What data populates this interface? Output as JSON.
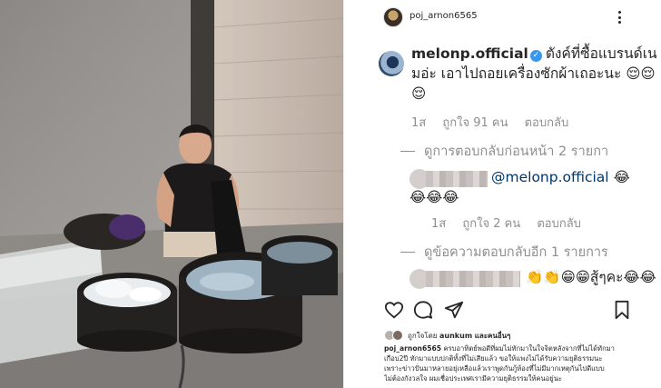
{
  "post": {
    "author": "poj_arnon6565"
  },
  "main_comment": {
    "username": "melonp.official",
    "text": "ตังค์ที่ซื้อแบรนด์เนมอ่ะ เอาไปถอยเครื่องซักผ้าเถอะนะ 😌😌😌",
    "time": "1ส",
    "likes": "ถูกใจ 91 คน",
    "reply_label": "ตอบกลับ"
  },
  "view_previous": "ดูการตอบกลับก่อนหน้า 2 รายกา",
  "reply1": {
    "mention": "@melonp.official",
    "emoji_line1": "😂",
    "emoji_line2": "😂😂😂",
    "time": "1ส",
    "likes": "ถูกใจ 2 คน",
    "reply_label": "ตอบกลับ"
  },
  "view_more": "ดูข้อความตอบกลับอีก 1 รายการ",
  "reply2": {
    "text": "👏👏😁😁สู้ๆคะ😂😂"
  },
  "likes_row": {
    "prefix": "ถูกใจโดย",
    "user": "aunkum",
    "suffix": "และคนอื่นๆ"
  },
  "caption": {
    "username": "poj_arnon6565",
    "line1": "ครบอาทิตย์พอดีที่ผมไม่ทักมาในใจจิตหลังจากที่ไม่ได้ทักมา",
    "line2": "เกือบ2ปี ทักมาแบบปกติทั้งที่ไม่เสียแล้ว ขอให้แพงไม่ได้รับความยุติธรรมนะ",
    "line3": "เพราะข่าวปั่นมาหลายอยุ่เหลือแล้วเราพูดกันกู้ห้องที่ไม่มีมากเหตุกันไปดีแบบ",
    "line4": "ไม่ต้องกังวลใจ ผมเชื่อประเทศเรามีความยุติธรรมให้คนอยู่นะ"
  },
  "colors": {
    "verified": "#3897f0",
    "mention": "#00376b",
    "meta": "#8e8e8e"
  },
  "icons": [
    "more-icon",
    "verified-icon",
    "heart-icon",
    "comment-icon",
    "share-icon",
    "bookmark-icon"
  ]
}
